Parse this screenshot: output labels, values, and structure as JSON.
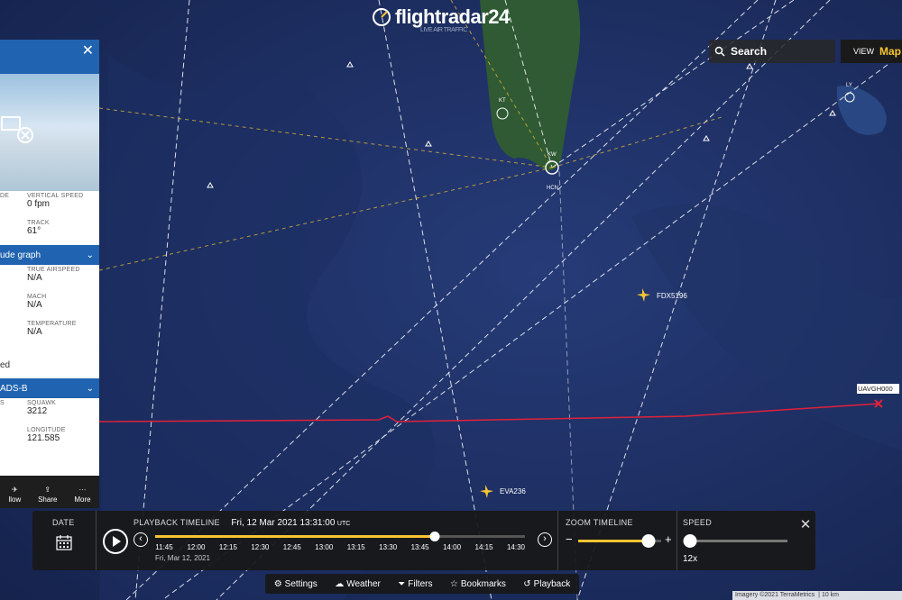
{
  "app": {
    "logo_text": "flightradar24",
    "logo_sub": "LIVE AIR TRAFFIC"
  },
  "search": {
    "label": "Search"
  },
  "view": {
    "label": "VIEW",
    "map_label": "Map"
  },
  "panel": {
    "stats": [
      {
        "left_label": "DE",
        "right_label": "VERTICAL SPEED",
        "right_value": "0 fpm"
      },
      {
        "left_label": "",
        "right_label": "TRACK",
        "right_value": "61°"
      }
    ],
    "section1": "ude graph",
    "stats2": [
      {
        "right_label": "TRUE AIRSPEED",
        "right_value": "N/A"
      },
      {
        "right_label": "MACH",
        "right_value": "N/A"
      },
      {
        "right_label": "TEMPERATURE",
        "right_value": "N/A"
      }
    ],
    "left_ed": "ed",
    "section2": "ADS-B",
    "stats3": [
      {
        "left_label": "S",
        "right_label": "SQUAWK",
        "right_value": "3212"
      },
      {
        "left_label": "",
        "right_label": "LONGITUDE",
        "right_value": "121.585"
      }
    ],
    "actions": [
      "llow",
      "Share",
      "More"
    ]
  },
  "flights": [
    {
      "callsign": "FDX5196"
    },
    {
      "callsign": "UAVGH000"
    },
    {
      "callsign": "EVA236"
    }
  ],
  "airports": [
    "KT",
    "KW",
    "HCN",
    "LY"
  ],
  "playback": {
    "date_label": "DATE",
    "timeline_label": "PLAYBACK TIMELINE",
    "timeline_datetime": "Fri, 12 Mar 2021 13:31:00",
    "timeline_tz": "UTC",
    "ticks": [
      "11:45",
      "12:00",
      "12:15",
      "12:30",
      "12:45",
      "13:00",
      "13:15",
      "13:30",
      "13:45",
      "14:00",
      "14:15",
      "14:30"
    ],
    "day_label": "Fri, Mar 12, 2021",
    "progress": 0.755,
    "zoom_label": "ZOOM TIMELINE",
    "zoom_level": 0.85,
    "speed_label": "SPEED",
    "speed_value": "12x",
    "speed_level": 0.0
  },
  "toolbar": [
    "Settings",
    "Weather",
    "Filters",
    "Bookmarks",
    "Playback"
  ],
  "attribution": "Imagery ©2021 TerraMetrics",
  "scale": "10 km",
  "colors": {
    "accent": "#f7c531",
    "panel_blue": "#2063b0",
    "track_red": "#e0213a"
  }
}
